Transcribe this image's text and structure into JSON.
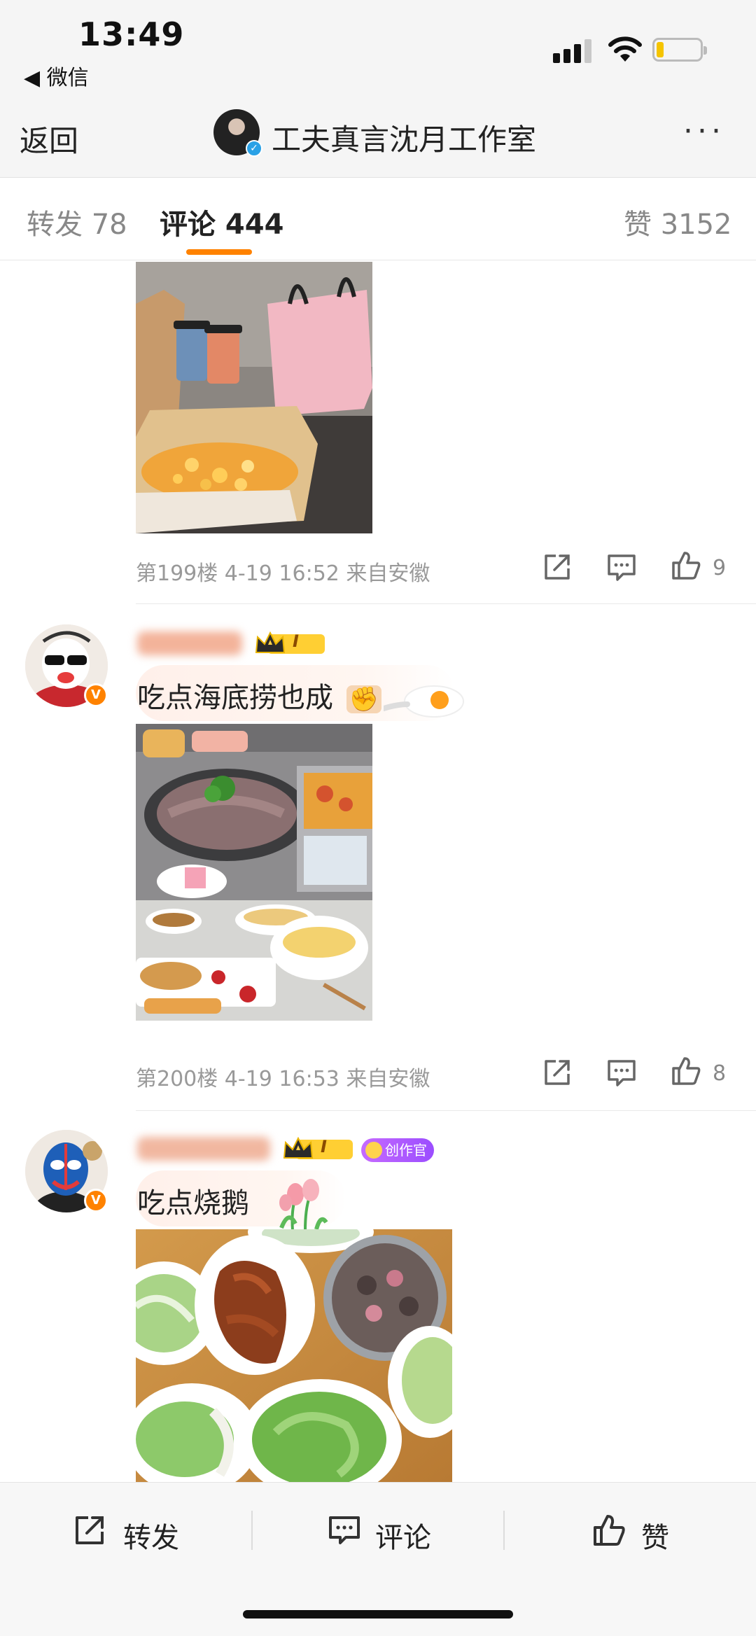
{
  "status_bar": {
    "time": "13:49",
    "back_app": "◀ 微信",
    "battery_color": "#f5c400"
  },
  "nav": {
    "back_label": "返回",
    "title": "工夫真言沈月工作室",
    "more_label": "···",
    "verified_mark": "✓"
  },
  "tabs": {
    "repost": "转发 78",
    "comment": "评论 444",
    "like": "赞 3152",
    "active": "comment",
    "accent_color": "#ff8200"
  },
  "comments": [
    {
      "floor_info": "第199楼 4-19 16:52 来自安徽",
      "like_count": "9",
      "image": "drinks-and-pizza-photo"
    },
    {
      "text": "吃点海底捞也成",
      "text_emoji": "✊",
      "floor_info": "第200楼 4-19 16:53 来自安徽",
      "like_count": "8",
      "badge_level": "I",
      "v_mark": "V",
      "image": "hotpot-collage-photo"
    },
    {
      "text": "吃点烧鹅",
      "badge_level": "I",
      "creator_label": "创作官",
      "v_mark": "V",
      "image": "roast-goose-photo"
    }
  ],
  "bottom_bar": {
    "repost": "转发",
    "comment": "评论",
    "like": "赞"
  }
}
